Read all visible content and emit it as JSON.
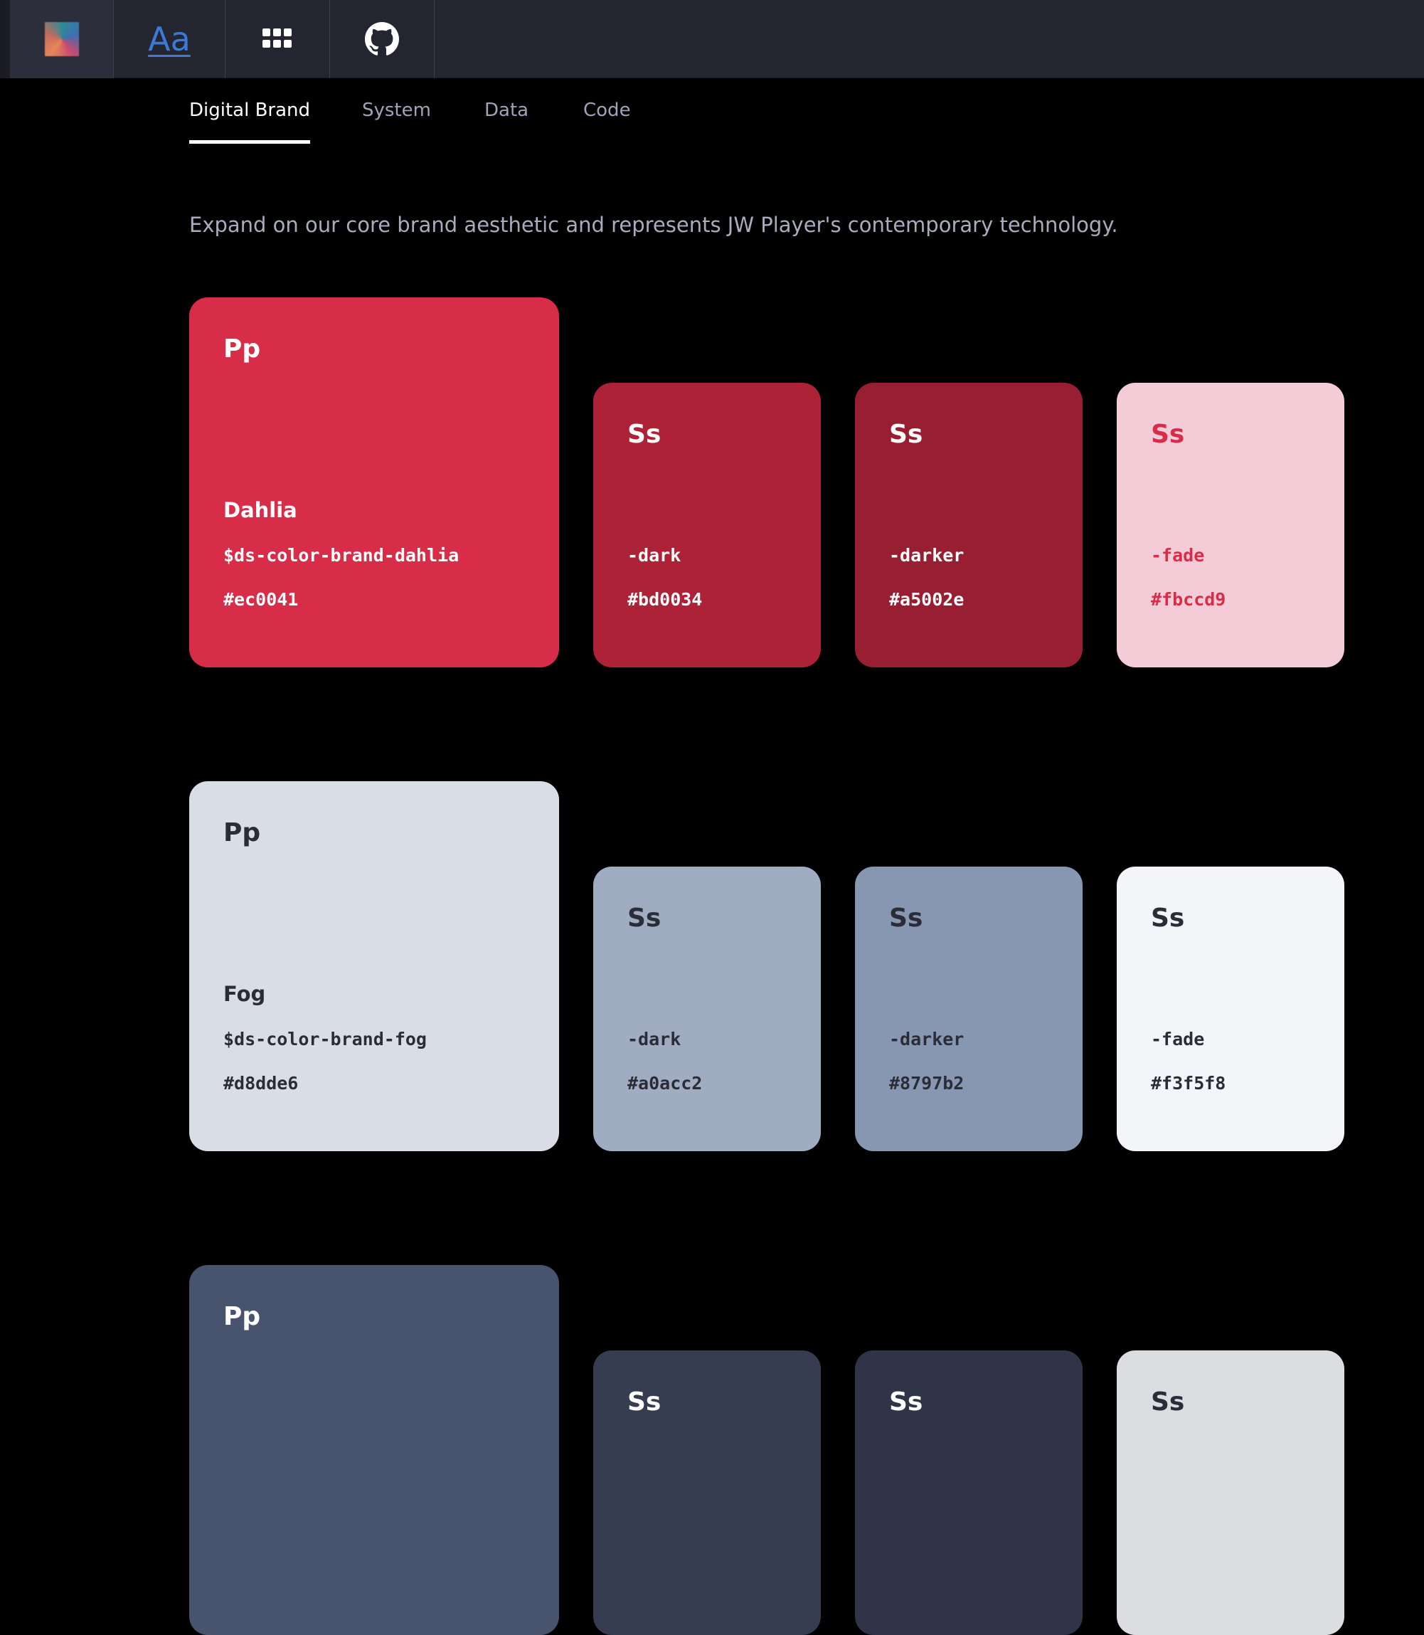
{
  "topbar": {
    "buttons": [
      {
        "name": "palette-logo-icon"
      },
      {
        "name": "typography-icon",
        "label": "Aa"
      },
      {
        "name": "grid-icon"
      },
      {
        "name": "github-icon"
      }
    ]
  },
  "tabs": [
    "Digital Brand",
    "System",
    "Data",
    "Code"
  ],
  "active_tab": "Digital Brand",
  "intro": "Expand on our core brand aesthetic and represents JW Player's contemporary technology.",
  "rows": [
    {
      "primary": {
        "sample": "Pp",
        "name": "Dahlia",
        "var": "$ds-color-brand-dahlia",
        "hex": "#ec0041",
        "bg": "#d82d48",
        "fg": "#ffffff"
      },
      "shades": [
        {
          "sample": "Ss",
          "suffix": "-dark",
          "hex": "#bd0034",
          "bg": "#ae2237",
          "fg": "#ffffff"
        },
        {
          "sample": "Ss",
          "suffix": "-darker",
          "hex": "#a5002e",
          "bg": "#981f32",
          "fg": "#ffffff"
        },
        {
          "sample": "Ss",
          "suffix": "-fade",
          "hex": "#fbccd9",
          "bg": "#f4ccd7",
          "fg": "#d82d48"
        }
      ]
    },
    {
      "primary": {
        "sample": "Pp",
        "name": "Fog",
        "var": "$ds-color-brand-fog",
        "hex": "#d8dde6",
        "bg": "#d8dde6",
        "fg": "#2a2d38"
      },
      "shades": [
        {
          "sample": "Ss",
          "suffix": "-dark",
          "hex": "#a0acc2",
          "bg": "#a0acc2",
          "fg": "#2a2d38"
        },
        {
          "sample": "Ss",
          "suffix": "-darker",
          "hex": "#8797b2",
          "bg": "#8797b2",
          "fg": "#2a2d38"
        },
        {
          "sample": "Ss",
          "suffix": "-fade",
          "hex": "#f3f5f8",
          "bg": "#f3f5f8",
          "fg": "#2a2d38"
        }
      ]
    },
    {
      "primary": {
        "sample": "Pp",
        "bg": "#48536d",
        "fg": "#ffffff"
      },
      "shades": [
        {
          "sample": "Ss",
          "bg": "#363d51",
          "fg": "#ffffff"
        },
        {
          "sample": "Ss",
          "bg": "#2f3546",
          "fg": "#ffffff"
        },
        {
          "sample": "Ss",
          "bg": "#dcdde1",
          "fg": "#2a2d38"
        }
      ]
    }
  ]
}
